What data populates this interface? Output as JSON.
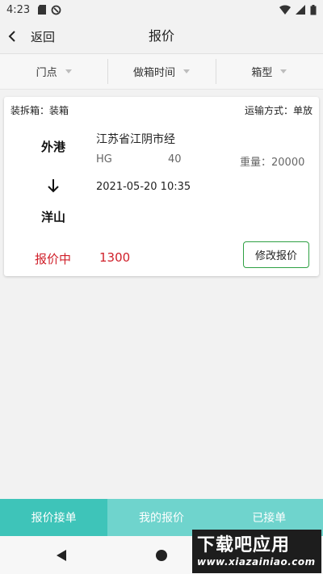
{
  "status_bar": {
    "time": "4:23"
  },
  "nav": {
    "back_label": "返回",
    "title": "报价"
  },
  "filters": [
    {
      "label": "门点"
    },
    {
      "label": "做箱时间"
    },
    {
      "label": "箱型"
    }
  ],
  "order": {
    "pack_type": "装拆箱：装箱",
    "transport_mode": "运输方式：单放",
    "from_port": "外港",
    "to_port": "洋山",
    "address": "江苏省江阴市经",
    "container_code": "HG",
    "container_size": "40",
    "weight": "重量：20000",
    "datetime": "2021-05-20 10:35",
    "status": "报价中",
    "price": "1300",
    "edit_button": "修改报价"
  },
  "tabs": [
    {
      "label": "报价接单",
      "active": true
    },
    {
      "label": "我的报价",
      "active": false
    },
    {
      "label": "已接单",
      "active": false
    }
  ],
  "watermark": {
    "title": "下载吧应用",
    "url": "www.xiazainiao.com"
  },
  "colors": {
    "accent": "#3ec4b9",
    "price_red": "#d0202a",
    "button_border": "#2ea043"
  }
}
